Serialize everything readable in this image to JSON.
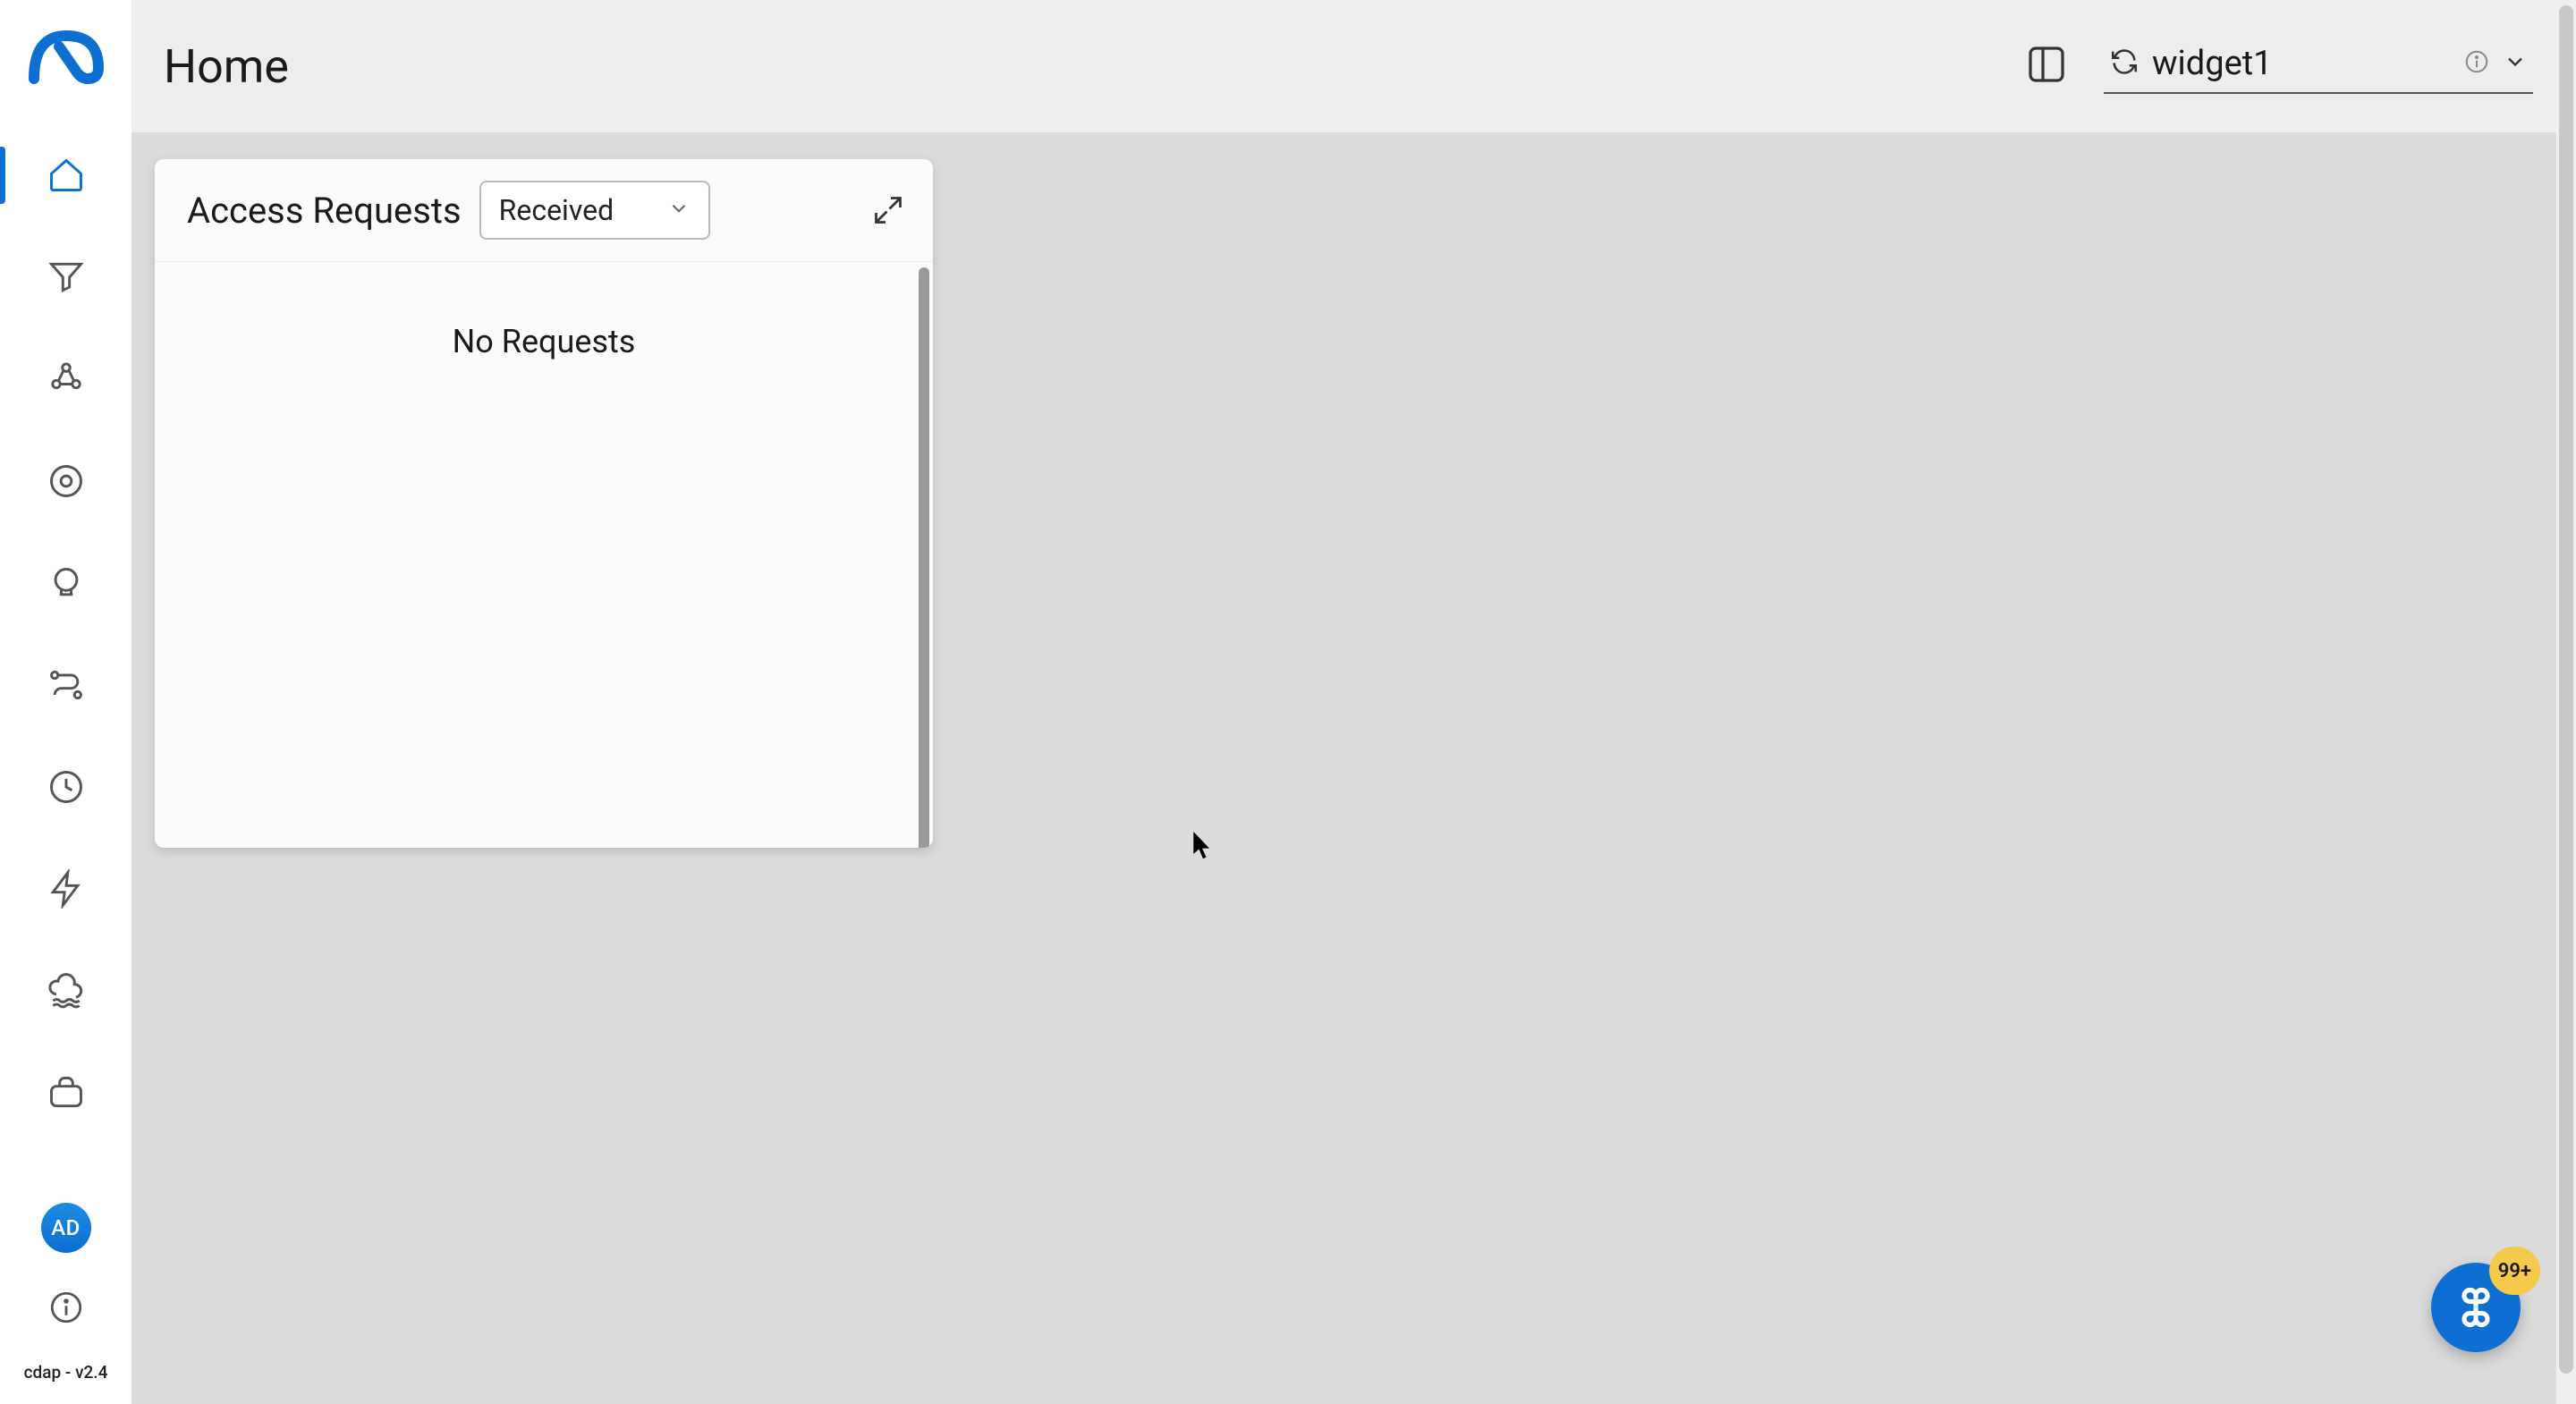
{
  "header": {
    "title": "Home",
    "layout_selector": "widget1"
  },
  "sidebar": {
    "avatar_initials": "AD",
    "version": "cdap - v2.4"
  },
  "widget": {
    "title": "Access Requests",
    "dropdown_value": "Received",
    "empty_text": "No Requests"
  },
  "fab": {
    "badge": "99+"
  }
}
